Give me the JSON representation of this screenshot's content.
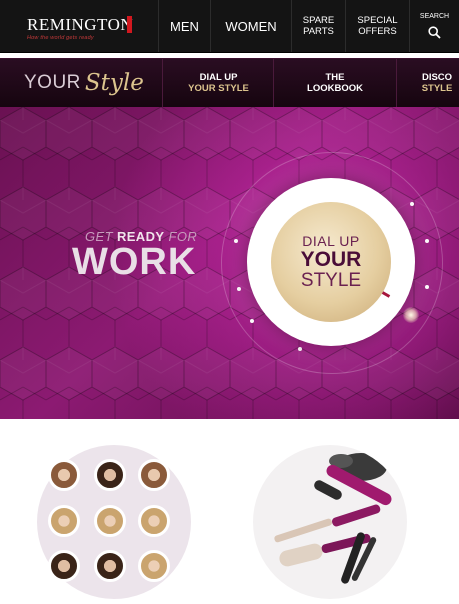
{
  "brand": {
    "name": "REMINGTON",
    "tagline": "How the world gets ready",
    "accent": "#d2181f"
  },
  "nav": {
    "men": "MEN",
    "women": "WOMEN",
    "spare_line1": "SPARE",
    "spare_line2": "PARTS",
    "offers_line1": "SPECIAL",
    "offers_line2": "OFFERS",
    "search_label": "SEARCH"
  },
  "subnav": {
    "your": "YOUR",
    "style": "Style",
    "dial_line1": "DIAL UP",
    "dial_line2": "YOUR STYLE",
    "look_line1": "THE",
    "look_line2": "LOOKBOOK",
    "disco_line1": "DISCO",
    "disco_line2": "STYLE"
  },
  "hero": {
    "get": "GET",
    "ready": "READY",
    "for": "FOR",
    "work": "WORK",
    "dial_line1": "DIAL UP",
    "dial_line2": "YOUR",
    "dial_line3": "STYLE",
    "bg_color": "#8c1a72",
    "gold": "#dcc48e"
  },
  "icons": [
    "search-icon"
  ]
}
